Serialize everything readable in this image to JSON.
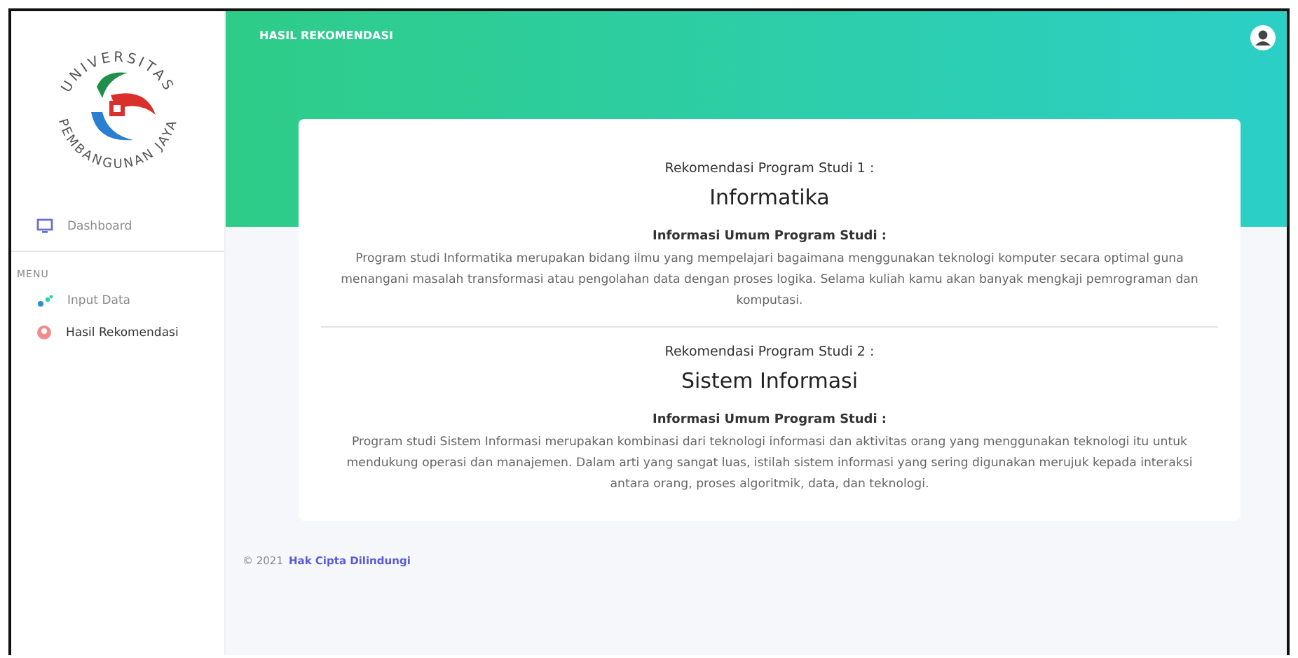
{
  "logo": {
    "top_text": "UNIVERSITAS",
    "bottom_text": "PEMBANGUNAN JAYA"
  },
  "sidebar": {
    "top_items": [
      {
        "label": "Dashboard",
        "kind": "monitor",
        "selected": false
      }
    ],
    "section": "MENU",
    "items": [
      {
        "label": "Input Data",
        "kind": "dots",
        "selected": false
      },
      {
        "label": "Hasil Rekomendasi",
        "kind": "user",
        "selected": true
      }
    ]
  },
  "header": {
    "title": "HASIL REKOMENDASI"
  },
  "recommendations": [
    {
      "heading": "Rekomendasi Program Studi 1 :",
      "program": "Informatika",
      "info_heading": "Informasi Umum Program Studi :",
      "description": "Program studi Informatika merupakan bidang ilmu yang mempelajari bagaimana menggunakan teknologi komputer secara optimal guna menangani masalah transformasi atau pengolahan data dengan proses logika. Selama kuliah kamu akan banyak mengkaji pemrograman dan komputasi."
    },
    {
      "heading": "Rekomendasi Program Studi 2 :",
      "program": "Sistem Informasi",
      "info_heading": "Informasi Umum Program Studi :",
      "description": "Program studi Sistem Informasi merupakan kombinasi dari teknologi informasi dan aktivitas orang yang menggunakan teknologi itu untuk mendukung operasi dan manajemen. Dalam arti yang sangat luas, istilah sistem informasi yang sering digunakan merujuk kepada interaksi antara orang, proses algoritmik, data, dan teknologi."
    }
  ],
  "footer": {
    "copyright": "© 2021",
    "link": "Hak Cipta Dilindungi"
  }
}
